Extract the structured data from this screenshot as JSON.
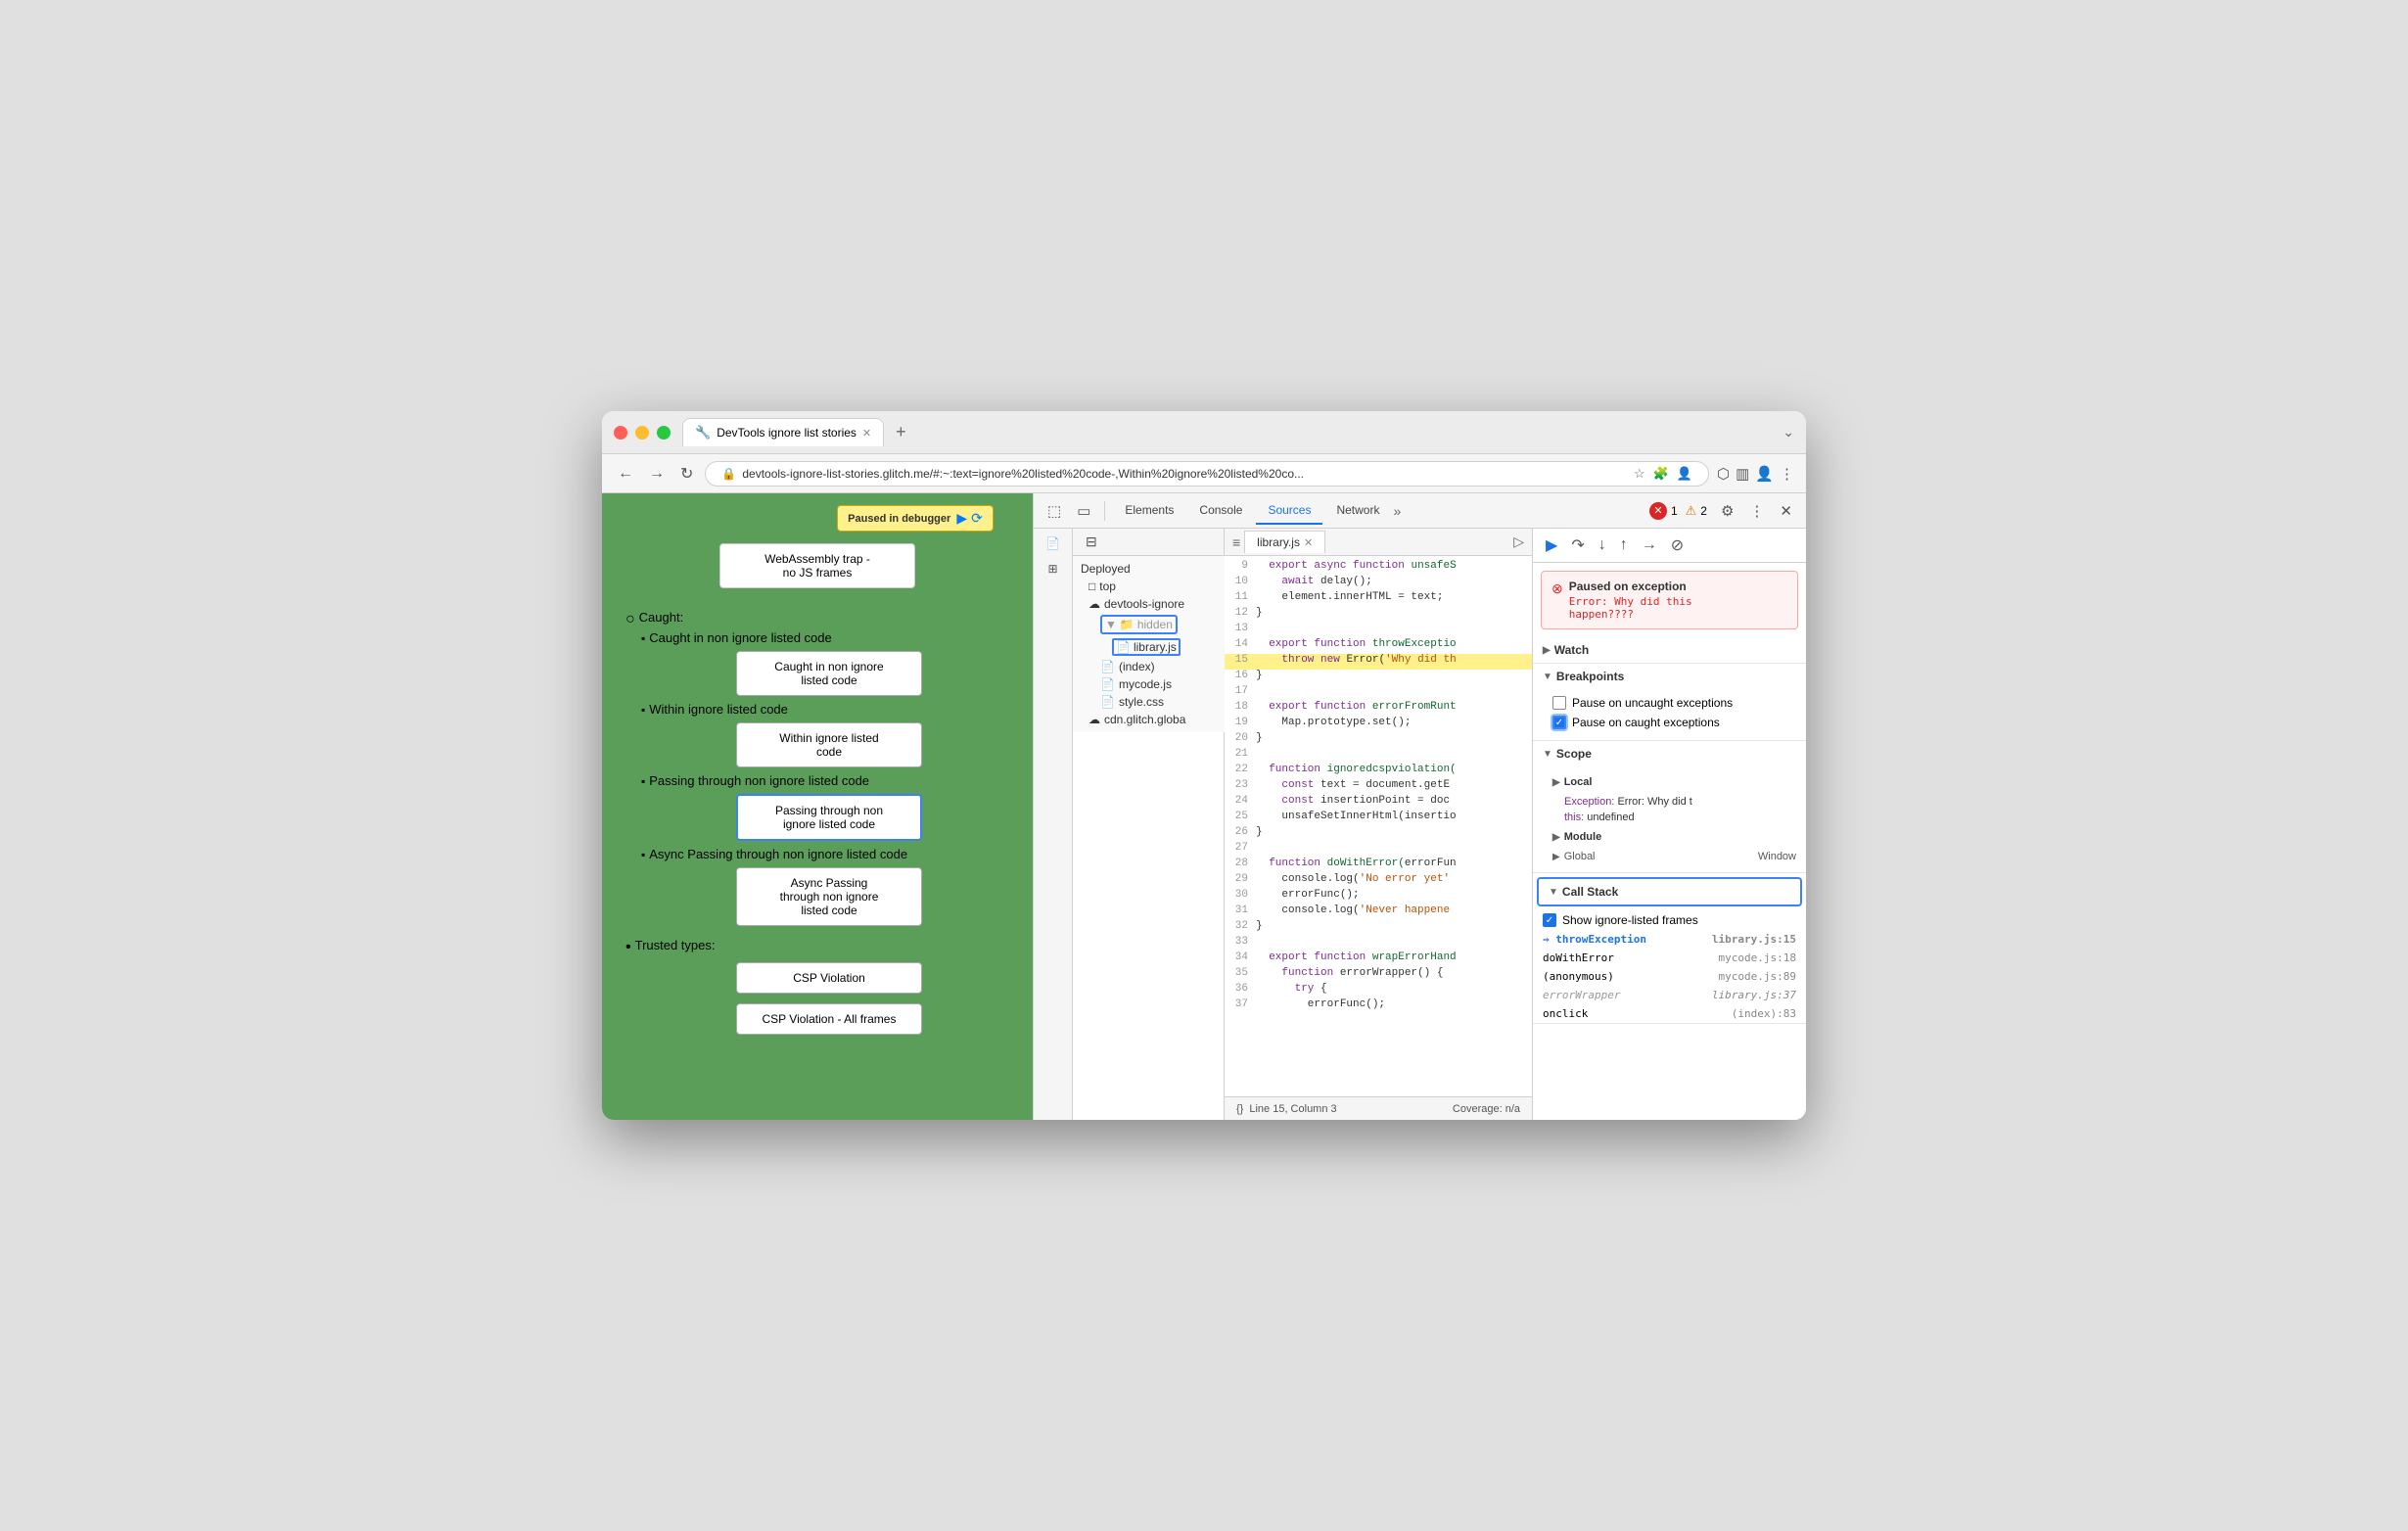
{
  "window": {
    "title": "DevTools ignore list stories",
    "tab_icon": "🔧",
    "url": "devtools-ignore-list-stories.glitch.me/#:~:text=ignore%20listed%20code-,Within%20ignore%20listed%20co..."
  },
  "devtools": {
    "tabs": [
      "Elements",
      "Console",
      "Sources",
      "Network"
    ],
    "active_tab": "Sources",
    "error_count": "1",
    "warning_count": "2",
    "file_tabs": [
      "library.js"
    ],
    "active_file": "library.js",
    "line_col": "Line 15, Column 3",
    "coverage": "Coverage: n/a"
  },
  "filetree": {
    "items": [
      {
        "label": "Deployed",
        "indent": 0,
        "type": "section"
      },
      {
        "label": "top",
        "indent": 1,
        "type": "folder"
      },
      {
        "label": "devtools-ignore",
        "indent": 1,
        "type": "cloud-folder"
      },
      {
        "label": "hidden",
        "indent": 2,
        "type": "folder",
        "selected": true,
        "highlighted": true
      },
      {
        "label": "library.js",
        "indent": 3,
        "type": "file",
        "highlighted": true
      },
      {
        "label": "(index)",
        "indent": 2,
        "type": "file"
      },
      {
        "label": "mycode.js",
        "indent": 2,
        "type": "file"
      },
      {
        "label": "style.css",
        "indent": 2,
        "type": "file"
      },
      {
        "label": "cdn.glitch.globa",
        "indent": 1,
        "type": "cloud-folder"
      }
    ]
  },
  "code": {
    "lines": [
      {
        "num": 9,
        "text": "  export async function unsafeS",
        "type": "normal"
      },
      {
        "num": 10,
        "text": "    await delay();",
        "type": "normal"
      },
      {
        "num": 11,
        "text": "    element.innerHTML = text;",
        "type": "normal"
      },
      {
        "num": 12,
        "text": "}",
        "type": "normal"
      },
      {
        "num": 13,
        "text": "",
        "type": "normal"
      },
      {
        "num": 14,
        "text": "export function throwExceptio",
        "type": "normal"
      },
      {
        "num": 15,
        "text": "  throw new Error('Why did th",
        "type": "highlighted"
      },
      {
        "num": 16,
        "text": "}",
        "type": "normal"
      },
      {
        "num": 17,
        "text": "",
        "type": "normal"
      },
      {
        "num": 18,
        "text": "export function errorFromRunt",
        "type": "normal"
      },
      {
        "num": 19,
        "text": "  Map.prototype.set();",
        "type": "normal"
      },
      {
        "num": 20,
        "text": "}",
        "type": "normal"
      },
      {
        "num": 21,
        "text": "",
        "type": "normal"
      },
      {
        "num": 22,
        "text": "function ignoredcspviolation(",
        "type": "normal"
      },
      {
        "num": 23,
        "text": "  const text = document.getE",
        "type": "normal"
      },
      {
        "num": 24,
        "text": "  const insertionPoint = doc",
        "type": "normal"
      },
      {
        "num": 25,
        "text": "  unsafeSetInnerHtml(insertio",
        "type": "normal"
      },
      {
        "num": 26,
        "text": "}",
        "type": "normal"
      },
      {
        "num": 27,
        "text": "",
        "type": "normal"
      },
      {
        "num": 28,
        "text": "function doWithError(errorFun",
        "type": "normal"
      },
      {
        "num": 29,
        "text": "  console.log('No error yet'",
        "type": "normal"
      },
      {
        "num": 30,
        "text": "  errorFunc();",
        "type": "normal"
      },
      {
        "num": 31,
        "text": "  console.log('Never happene",
        "type": "normal"
      },
      {
        "num": 32,
        "text": "}",
        "type": "normal"
      },
      {
        "num": 33,
        "text": "",
        "type": "normal"
      },
      {
        "num": 34,
        "text": "export function wrapErrorHand",
        "type": "normal"
      },
      {
        "num": 35,
        "text": "  function errorWrapper() {",
        "type": "normal"
      },
      {
        "num": 36,
        "text": "    try {",
        "type": "normal"
      },
      {
        "num": 37,
        "text": "      errorFunc();",
        "type": "normal"
      }
    ]
  },
  "right_panel": {
    "exception_title": "Paused on exception",
    "exception_error": "Error: Why did this\nhappen????",
    "sections": {
      "watch": "Watch",
      "breakpoints": "Breakpoints",
      "scope": "Scope",
      "call_stack": "Call Stack"
    },
    "breakpoint_options": [
      {
        "label": "Pause on uncaught exceptions",
        "checked": false
      },
      {
        "label": "Pause on caught exceptions",
        "checked": true
      }
    ],
    "scope_local": "Local",
    "scope_exception": "Exception: Error: Why did t",
    "scope_this": "this: undefined",
    "scope_module": "Module",
    "scope_global": "Global",
    "scope_global_val": "Window",
    "call_stack_show_ignored": "Show ignore-listed frames",
    "call_stack_frames": [
      {
        "fn": "throwException",
        "loc": "library.js:15",
        "type": "active"
      },
      {
        "fn": "doWithError",
        "loc": "mycode.js:18",
        "type": "normal"
      },
      {
        "fn": "(anonymous)",
        "loc": "mycode.js:89",
        "type": "normal"
      },
      {
        "fn": "errorWrapper",
        "loc": "library.js:37",
        "type": "ignored"
      },
      {
        "fn": "onclick",
        "loc": "(index):83",
        "type": "normal"
      }
    ]
  },
  "webpage": {
    "paused_label": "Paused in debugger",
    "webassembly_text": "WebAssembly trap -\nno JS frames",
    "caught_label": "Caught:",
    "items": [
      {
        "type": "sub",
        "label": "Caught in non ignore listed code",
        "btn": "Caught in non ignore\nlisted code"
      },
      {
        "type": "sub",
        "label": "Within ignore listed code",
        "btn": "Within ignore listed\ncode"
      },
      {
        "type": "sub",
        "label": "Passing through non ignore listed code",
        "btn": "Passing through non\nignore listed code",
        "active": true
      },
      {
        "type": "sub",
        "label": "Async Passing through non ignore listed code",
        "btn": "Async Passing\nthrough non ignore\nlisted code"
      }
    ],
    "trusted_label": "Trusted types:",
    "trusted_items": [
      {
        "label": "CSP Violation"
      },
      {
        "label": "CSP Violation - All frames"
      }
    ]
  }
}
